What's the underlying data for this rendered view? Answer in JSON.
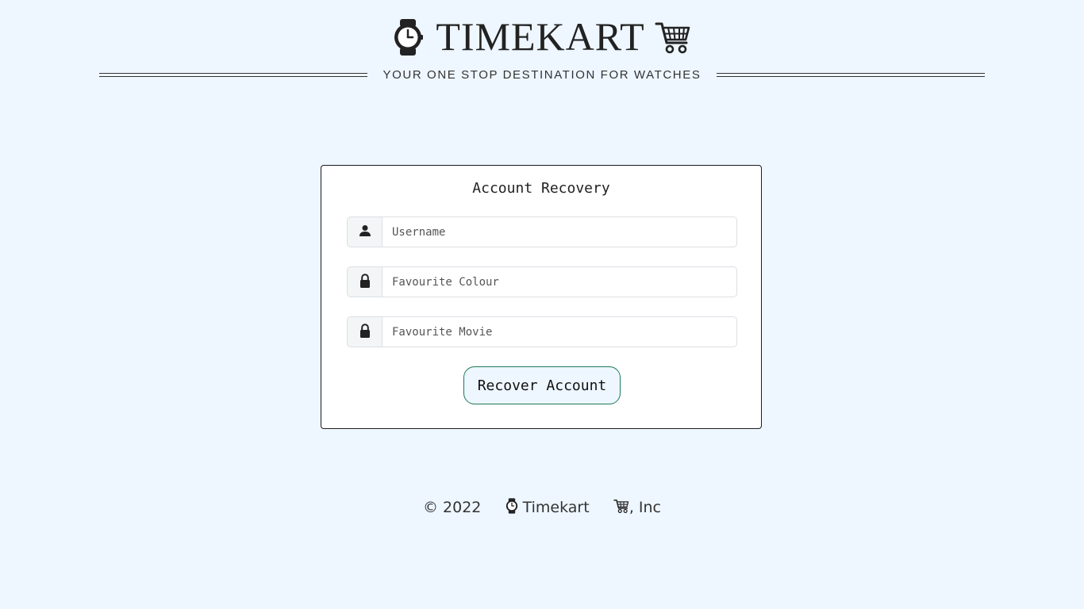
{
  "header": {
    "brand_name": "TIMEKART",
    "tagline": "YOUR ONE STOP DESTINATION FOR WATCHES",
    "left_icon": "watch-icon",
    "right_icon": "cart-icon"
  },
  "recovery_form": {
    "title": "Account Recovery",
    "fields": [
      {
        "icon": "user-icon",
        "placeholder": "Username",
        "value": ""
      },
      {
        "icon": "lock-icon",
        "placeholder": "Favourite Colour",
        "value": ""
      },
      {
        "icon": "lock-icon",
        "placeholder": "Favourite Movie",
        "value": ""
      }
    ],
    "submit_label": "Recover Account"
  },
  "footer": {
    "copyright_year": "© 2022",
    "company": "Timekart",
    "suffix": ", Inc"
  },
  "colors": {
    "page_background": "#eef6ff",
    "card_background": "#ffffff",
    "button_border": "#1f7a5a",
    "text": "#222222"
  }
}
